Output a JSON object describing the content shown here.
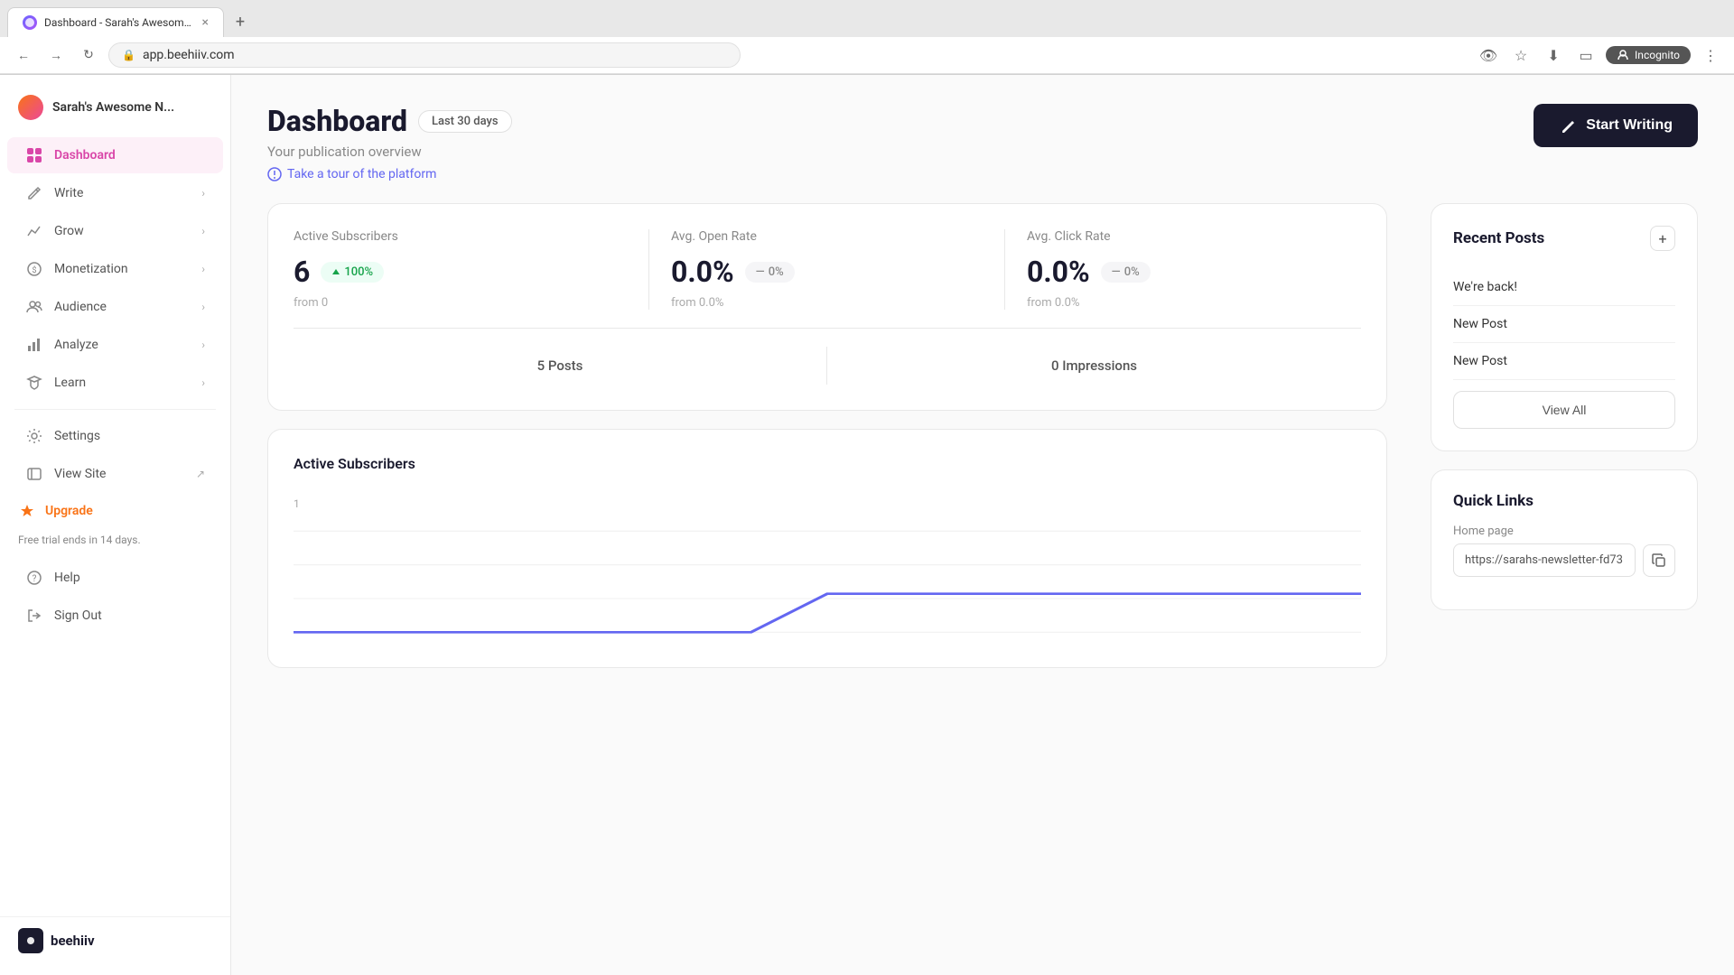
{
  "browser": {
    "tab_title": "Dashboard - Sarah's Awesome N...",
    "tab_close": "×",
    "new_tab": "+",
    "address": "app.beehiiv.com",
    "incognito_label": "Incognito"
  },
  "sidebar": {
    "pub_name": "Sarah's Awesome N...",
    "nav_items": [
      {
        "id": "dashboard",
        "label": "Dashboard",
        "active": true
      },
      {
        "id": "write",
        "label": "Write",
        "has_chevron": true
      },
      {
        "id": "grow",
        "label": "Grow",
        "has_chevron": true
      },
      {
        "id": "monetization",
        "label": "Monetization",
        "has_chevron": true
      },
      {
        "id": "audience",
        "label": "Audience",
        "has_chevron": true
      },
      {
        "id": "analyze",
        "label": "Analyze",
        "has_chevron": true
      },
      {
        "id": "learn",
        "label": "Learn",
        "has_chevron": true
      }
    ],
    "bottom_items": [
      {
        "id": "settings",
        "label": "Settings"
      },
      {
        "id": "view-site",
        "label": "View Site",
        "external": true
      }
    ],
    "upgrade_label": "Upgrade",
    "free_trial_text": "Free trial ends in 14 days.",
    "help_label": "Help",
    "sign_out_label": "Sign Out",
    "logo_text": "beehiiv"
  },
  "dashboard": {
    "title": "Dashboard",
    "days_badge": "Last 30 days",
    "subtitle": "Your publication overview",
    "tour_link": "Take a tour of the platform",
    "start_writing_btn": "Start Writing"
  },
  "stats": {
    "active_subscribers_label": "Active Subscribers",
    "active_subscribers_value": "6",
    "active_subscribers_badge": "100%",
    "active_subscribers_from": "from 0",
    "avg_open_rate_label": "Avg. Open Rate",
    "avg_open_rate_value": "0.0%",
    "avg_open_rate_badge": "0%",
    "avg_open_rate_from": "from 0.0%",
    "avg_click_rate_label": "Avg. Click Rate",
    "avg_click_rate_value": "0.0%",
    "avg_click_rate_badge": "0%",
    "avg_click_rate_from": "from 0.0%",
    "posts_count": "5 Posts",
    "impressions_count": "0 Impressions"
  },
  "chart": {
    "title": "Active Subscribers",
    "y_label": "1",
    "menu_icon": "⋮"
  },
  "recent_posts": {
    "title": "Recent Posts",
    "add_btn": "+",
    "posts": [
      {
        "title": "We're back!"
      },
      {
        "title": "New Post"
      },
      {
        "title": "New Post"
      }
    ],
    "view_all_label": "View All"
  },
  "quick_links": {
    "title": "Quick Links",
    "home_page_label": "Home page",
    "home_page_url": "https://sarahs-newsletter-fd73",
    "copy_icon": "⧉"
  },
  "colors": {
    "accent_purple": "#d946a8",
    "accent_orange": "#f97316",
    "dark": "#1a1a2e",
    "green": "#16a34a"
  }
}
